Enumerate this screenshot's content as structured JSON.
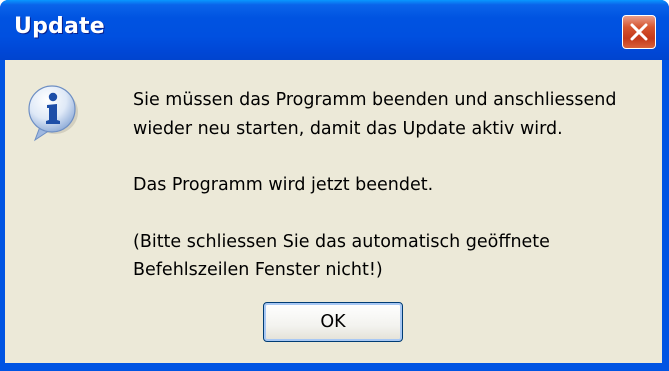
{
  "window": {
    "title": "Update"
  },
  "titlebar": {
    "close_icon": "close-icon"
  },
  "dialog": {
    "icon": "info-icon",
    "message_lines": [
      "Sie müssen das Programm beenden und anschliessend",
      "wieder neu starten, damit das Update aktiv wird.",
      "",
      "Das Programm wird jetzt beendet.",
      "",
      "(Bitte schliessen Sie das automatisch geöffnete",
      "Befehlszeilen Fenster nicht!)"
    ],
    "ok_label": "OK"
  },
  "colors": {
    "titlebar_blue": "#0054e3",
    "close_red": "#d6552f",
    "dialog_background": "#ece9d8"
  }
}
